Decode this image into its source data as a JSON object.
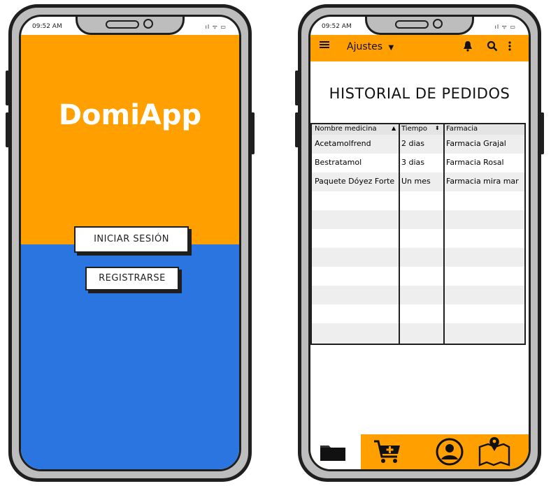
{
  "phone_left": {
    "status": {
      "time": "09:52 AM",
      "icons": "ıl ᯤ ▭"
    },
    "app_name": "DomiApp",
    "login_label": "INICIAR SESIÓN",
    "register_label": "REGISTRARSE",
    "colors": {
      "top": "#ff9f00",
      "bottom": "#2b75e0"
    }
  },
  "phone_right": {
    "status": {
      "time": "09:52 AM",
      "icons": "ıl ᯤ ▭"
    },
    "topbar": {
      "menu_icon": "hamburger-menu-icon",
      "title": "Ajustes",
      "dropdown_icon": "caret-down-icon",
      "bell_icon": "bell-icon",
      "search_icon": "search-icon",
      "more_icon": "more-vertical-icon"
    },
    "title": "HISTORIAL DE PEDIDOS",
    "table": {
      "columns": [
        "Nombre medicina",
        "Tiempo",
        "Farmacia"
      ],
      "rows": [
        [
          "Acetamolfrend",
          "2 dias",
          "Farmacia Grajal"
        ],
        [
          "Bestratamol",
          "3 dias",
          "Farmacia Rosal"
        ],
        [
          "Paquete Dóyez Forte",
          "Un mes",
          "Farmacia mira mar"
        ]
      ]
    },
    "bottom_nav": [
      "folder-icon",
      "cart-add-icon",
      "user-profile-icon",
      "map-pin-icon"
    ],
    "colors": {
      "accent": "#ff9f00"
    }
  }
}
